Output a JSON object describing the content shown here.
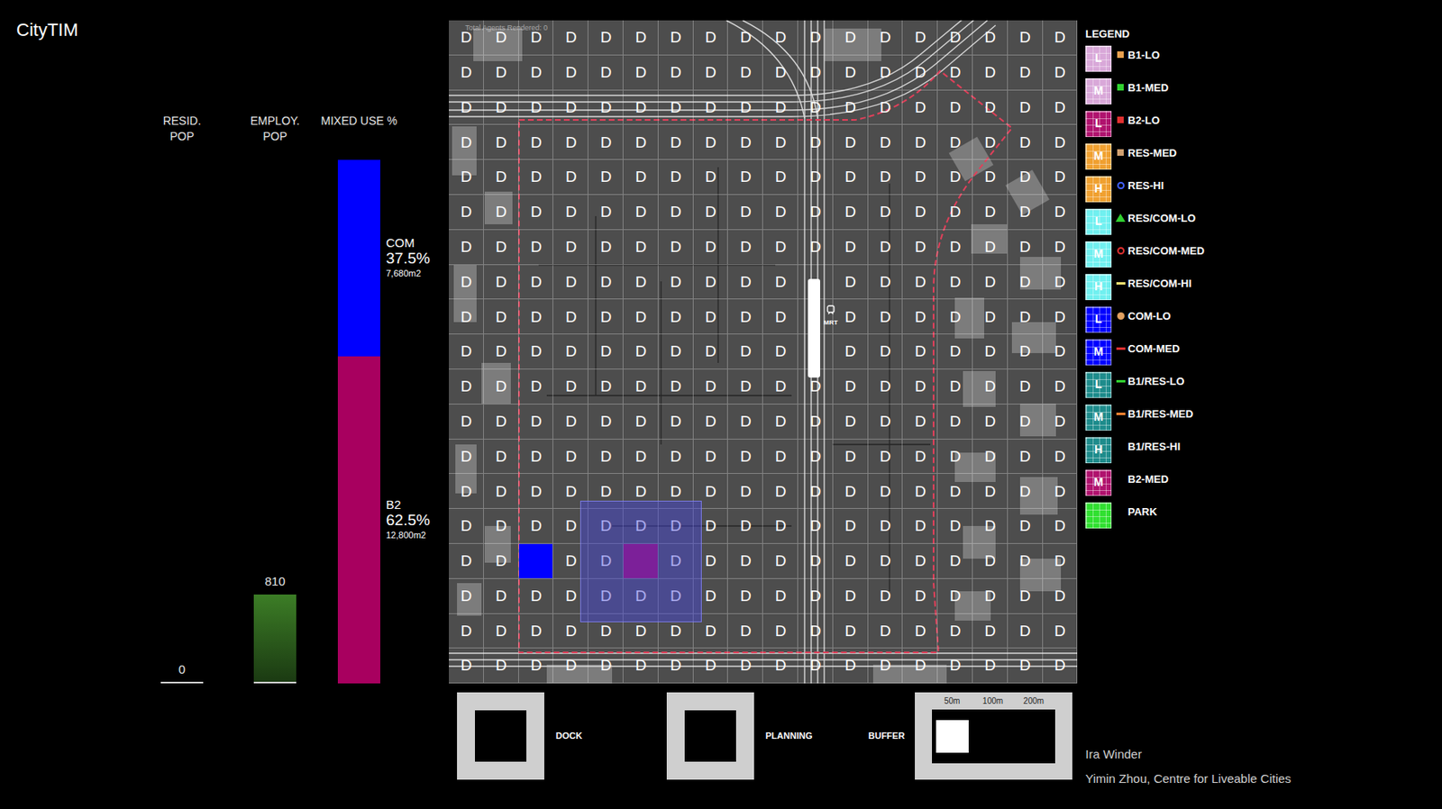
{
  "app": {
    "title": "CityTIM"
  },
  "indicators": {
    "resid": {
      "label": "RESID. POP",
      "value": "0",
      "level": 0
    },
    "employ": {
      "label": "EMPLOY. POP",
      "value": "810",
      "level": 0.17
    },
    "mixed": {
      "label": "MIXED USE %",
      "segments": [
        {
          "name": "COM",
          "percent": "37.5%",
          "area": "7,680m2",
          "level": 0.375,
          "color": "#0000ff"
        },
        {
          "name": "B2",
          "percent": "62.5%",
          "area": "12,800m2",
          "level": 0.625,
          "color": "#a8005f"
        }
      ]
    }
  },
  "map": {
    "agents_text": "Total Agents Rendered: 0",
    "station_label": "MRT",
    "rows": [
      [
        "D",
        "D",
        "D",
        "D",
        "D",
        "D",
        "D",
        "D",
        "D",
        "D",
        "D",
        "D",
        "D",
        "D",
        "D",
        "D",
        "D",
        "D"
      ],
      [
        "D",
        "D",
        "D",
        "D",
        "D",
        "D",
        "D",
        "D",
        "D",
        "D",
        "D",
        "D",
        "D",
        "D",
        "D",
        "D",
        "D",
        "D"
      ],
      [
        "D",
        "D",
        "D",
        "D",
        "D",
        "D",
        "D",
        "D",
        "D",
        "D",
        "D",
        "D",
        "D",
        "D",
        "D",
        "D",
        "D",
        "D"
      ],
      [
        "D",
        "D",
        "D",
        "D",
        "D",
        "D",
        "D",
        "D",
        "D",
        "D",
        "D",
        "D",
        "D",
        "D",
        "D",
        "D",
        "D",
        "D"
      ],
      [
        "D",
        "D",
        "D",
        "D",
        "D",
        "D",
        "D",
        "D",
        "D",
        "D",
        "D",
        "D",
        "D",
        "D",
        "D",
        "D",
        "D",
        "D"
      ],
      [
        "D",
        "D",
        "D",
        "D",
        "D",
        "D",
        "D",
        "D",
        "D",
        "D",
        "D",
        "D",
        "D",
        "D",
        "D",
        "D",
        "D",
        "D"
      ],
      [
        "D",
        "D",
        "D",
        "D",
        "D",
        "D",
        "D",
        "D",
        "D",
        "D",
        "D",
        "D",
        "D",
        "D",
        "D",
        "D",
        "D",
        "D"
      ],
      [
        "D",
        "D",
        "D",
        "D",
        "D",
        "D",
        "D",
        "D",
        "D",
        "D",
        "",
        "D",
        "D",
        "D",
        "D",
        "D",
        "D",
        "D"
      ],
      [
        "D",
        "D",
        "D",
        "D",
        "D",
        "D",
        "D",
        "D",
        "D",
        "D",
        "",
        "D",
        "D",
        "D",
        "D",
        "D",
        "D",
        "D"
      ],
      [
        "D",
        "D",
        "D",
        "D",
        "D",
        "D",
        "D",
        "D",
        "D",
        "D",
        "",
        "D",
        "D",
        "D",
        "D",
        "D",
        "D",
        "D"
      ],
      [
        "D",
        "D",
        "D",
        "D",
        "D",
        "D",
        "D",
        "D",
        "D",
        "D",
        "D",
        "D",
        "D",
        "D",
        "D",
        "D",
        "D",
        "D"
      ],
      [
        "D",
        "D",
        "D",
        "D",
        "D",
        "D",
        "D",
        "D",
        "D",
        "D",
        "D",
        "D",
        "D",
        "D",
        "D",
        "D",
        "D",
        "D"
      ],
      [
        "D",
        "D",
        "D",
        "D",
        "D",
        "D",
        "D",
        "D",
        "D",
        "D",
        "D",
        "D",
        "D",
        "D",
        "D",
        "D",
        "D",
        "D"
      ],
      [
        "D",
        "D",
        "D",
        "D",
        "D",
        "D",
        "D",
        "D",
        "D",
        "D",
        "D",
        "D",
        "D",
        "D",
        "D",
        "D",
        "D",
        "D"
      ],
      [
        "D",
        "D",
        "D",
        "D",
        "D",
        "D",
        "D",
        "D",
        "D",
        "D",
        "D",
        "D",
        "D",
        "D",
        "D",
        "D",
        "D",
        "D"
      ],
      [
        "D",
        "D",
        "",
        "D",
        "D",
        "",
        "D",
        "D",
        "D",
        "D",
        "D",
        "D",
        "D",
        "D",
        "D",
        "D",
        "D",
        "D"
      ],
      [
        "D",
        "D",
        "D",
        "D",
        "D",
        "D",
        "D",
        "D",
        "D",
        "D",
        "D",
        "D",
        "D",
        "D",
        "D",
        "D",
        "D",
        "D"
      ],
      [
        "D",
        "D",
        "D",
        "D",
        "D",
        "D",
        "D",
        "D",
        "D",
        "D",
        "D",
        "D",
        "D",
        "D",
        "D",
        "D",
        "D",
        "D"
      ],
      [
        "D",
        "D",
        "D",
        "D",
        "D",
        "D",
        "D",
        "D",
        "D",
        "D",
        "D",
        "D",
        "D",
        "D",
        "D",
        "D",
        "D",
        "D"
      ]
    ],
    "tiles": [
      {
        "row": 15,
        "col": 2,
        "kind": "com-lo",
        "color": "#0000ff"
      },
      {
        "row": 15,
        "col": 5,
        "kind": "b2-lo",
        "color": "#a8005f"
      }
    ],
    "buffer": {
      "row": 15,
      "col": 5,
      "radius": 1.75
    }
  },
  "controls": {
    "dock": {
      "label": "DOCK"
    },
    "planning": {
      "label": "PLANNING"
    },
    "buffer": {
      "label": "BUFFER",
      "options": [
        {
          "label": "50m",
          "selected": true
        },
        {
          "label": "100m",
          "selected": false
        },
        {
          "label": "200m",
          "selected": false
        }
      ]
    }
  },
  "legend": {
    "title": "LEGEND",
    "items": [
      {
        "label": "B1-LO",
        "tile": "L",
        "color": "#d9a8d9",
        "marker": {
          "kind": "square",
          "color": "#e8a050"
        }
      },
      {
        "label": "B1-MED",
        "tile": "M",
        "color": "#d9a8d9",
        "marker": {
          "kind": "square",
          "color": "#30d030"
        }
      },
      {
        "label": "B2-LO",
        "tile": "L",
        "color": "#b0126e",
        "marker": {
          "kind": "square",
          "color": "#e03030"
        }
      },
      {
        "label": "RES-MED",
        "tile": "M",
        "color": "#f0a030",
        "marker": {
          "kind": "square",
          "color": "#d0a070"
        }
      },
      {
        "label": "RES-HI",
        "tile": "H",
        "color": "#f0a030",
        "marker": {
          "kind": "circle",
          "color": "#4060ff"
        }
      },
      {
        "label": "RES/COM-LO",
        "tile": "L",
        "color": "#70f0f0",
        "marker": {
          "kind": "triangle",
          "color": "#30d030"
        }
      },
      {
        "label": "RES/COM-MED",
        "tile": "M",
        "color": "#70f0f0",
        "marker": {
          "kind": "circle",
          "color": "#e03030"
        }
      },
      {
        "label": "RES/COM-HI",
        "tile": "H",
        "color": "#70f0f0",
        "marker": {
          "kind": "dash",
          "color": "#f0e070"
        }
      },
      {
        "label": "COM-LO",
        "tile": "L",
        "color": "#0000ff",
        "marker": {
          "kind": "disc",
          "color": "#e0a060"
        }
      },
      {
        "label": "COM-MED",
        "tile": "M",
        "color": "#0000ff",
        "marker": {
          "kind": "dash",
          "color": "#e03030"
        }
      },
      {
        "label": "B1/RES-LO",
        "tile": "L",
        "color": "#1e8c8c",
        "marker": {
          "kind": "dash",
          "color": "#30d030"
        }
      },
      {
        "label": "B1/RES-MED",
        "tile": "M",
        "color": "#1e8c8c",
        "marker": {
          "kind": "dash",
          "color": "#f08030"
        }
      },
      {
        "label": "B1/RES-HI",
        "tile": "H",
        "color": "#1e8c8c",
        "marker": {
          "kind": "none"
        }
      },
      {
        "label": "B2-MED",
        "tile": "M",
        "color": "#b0126e",
        "marker": {
          "kind": "none"
        }
      },
      {
        "label": "PARK",
        "tile": "",
        "color": "#30e030",
        "marker": {
          "kind": "none"
        }
      }
    ]
  },
  "credits": [
    "Ira Winder",
    "Yimin Zhou, Centre for Liveable Cities"
  ]
}
